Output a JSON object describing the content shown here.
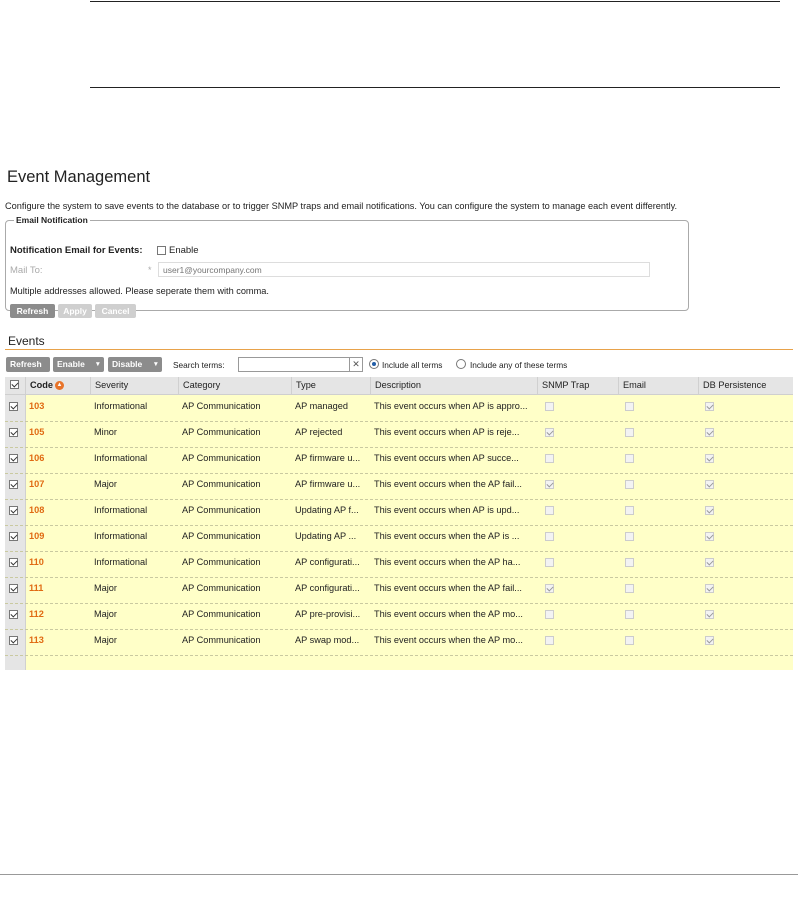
{
  "page": {
    "title": "Event Management",
    "description": "Configure the system to save events to the database or to trigger SNMP traps and email notifications. You can configure the system to manage each event differently."
  },
  "email_notification": {
    "legend": "Email Notification",
    "notification_label": "Notification Email for Events:",
    "enable_label": "Enable",
    "enable_checked": false,
    "mail_to_label": "Mail To:",
    "required_mark": "*",
    "mail_to_placeholder": "user1@yourcompany.com",
    "note": "Multiple addresses allowed. Please seperate them with comma.",
    "buttons": {
      "refresh": "Refresh",
      "apply": "Apply",
      "cancel": "Cancel"
    }
  },
  "events": {
    "title": "Events",
    "toolbar": {
      "refresh": "Refresh",
      "enable": "Enable",
      "disable": "Disable",
      "dropdown_glyph": "▼",
      "search_label": "Search terms:",
      "search_value": "",
      "clear_glyph": "✕",
      "radio_all": "Include all terms",
      "radio_any": "Include any of these terms",
      "radio_selected": "all"
    },
    "columns": {
      "code": "Code",
      "severity": "Severity",
      "category": "Category",
      "type": "Type",
      "description": "Description",
      "snmp": "SNMP Trap",
      "email": "Email",
      "db": "DB Persistence"
    },
    "sort_icon": "up-arrow-icon",
    "header_checked": true,
    "rows": [
      {
        "code": "103",
        "severity": "Informational",
        "category": "AP Communication",
        "type": "AP managed",
        "description": "This event occurs when AP is appro...",
        "snmp": false,
        "email": false,
        "db": true,
        "selected": true
      },
      {
        "code": "105",
        "severity": "Minor",
        "category": "AP Communication",
        "type": "AP rejected",
        "description": "This event occurs when AP is reje...",
        "snmp": true,
        "email": false,
        "db": true,
        "selected": true
      },
      {
        "code": "106",
        "severity": "Informational",
        "category": "AP Communication",
        "type": "AP firmware u...",
        "description": "This event occurs when AP succe...",
        "snmp": false,
        "email": false,
        "db": true,
        "selected": true
      },
      {
        "code": "107",
        "severity": "Major",
        "category": "AP Communication",
        "type": "AP firmware u...",
        "description": "This event occurs when the AP fail...",
        "snmp": true,
        "email": false,
        "db": true,
        "selected": true
      },
      {
        "code": "108",
        "severity": "Informational",
        "category": "AP Communication",
        "type": "Updating AP f...",
        "description": "This event occurs when AP is upd...",
        "snmp": false,
        "email": false,
        "db": true,
        "selected": true
      },
      {
        "code": "109",
        "severity": "Informational",
        "category": "AP Communication",
        "type": "Updating AP ...",
        "description": "This event occurs when the AP is ...",
        "snmp": false,
        "email": false,
        "db": true,
        "selected": true
      },
      {
        "code": "110",
        "severity": "Informational",
        "category": "AP Communication",
        "type": "AP configurati...",
        "description": "This event occurs when the AP ha...",
        "snmp": false,
        "email": false,
        "db": true,
        "selected": true
      },
      {
        "code": "111",
        "severity": "Major",
        "category": "AP Communication",
        "type": "AP configurati...",
        "description": "This event occurs when the AP fail...",
        "snmp": true,
        "email": false,
        "db": true,
        "selected": true
      },
      {
        "code": "112",
        "severity": "Major",
        "category": "AP Communication",
        "type": "AP pre-provisi...",
        "description": "This event occurs when the AP mo...",
        "snmp": false,
        "email": false,
        "db": true,
        "selected": true
      },
      {
        "code": "113",
        "severity": "Major",
        "category": "AP Communication",
        "type": "AP swap mod...",
        "description": "This event occurs when the AP mo...",
        "snmp": false,
        "email": false,
        "db": true,
        "selected": true
      }
    ]
  }
}
